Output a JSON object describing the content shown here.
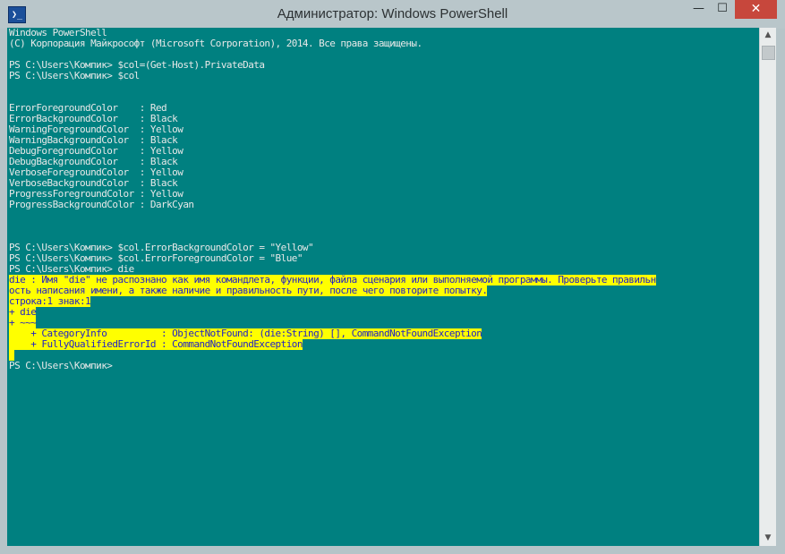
{
  "window": {
    "title": "Администратор: Windows PowerShell",
    "app_icon_glyph": "❯_",
    "buttons": {
      "minimize": "—",
      "maximize": "☐",
      "close": "✕"
    }
  },
  "colors": {
    "console_background": "#008080",
    "console_foreground": "#e8e8e8",
    "error_background": "#ffff00",
    "error_foreground": "#1f1fc8",
    "close_button": "#c7473c"
  },
  "console": {
    "lines": [
      {
        "text": "Windows PowerShell",
        "type": "normal"
      },
      {
        "text": "(С) Корпорация Майкрософт (Microsoft Corporation), 2014. Все права защищены.",
        "type": "normal"
      },
      {
        "text": "",
        "type": "normal"
      },
      {
        "text": "PS C:\\Users\\Компик> $col=(Get-Host).PrivateData",
        "type": "normal"
      },
      {
        "text": "PS C:\\Users\\Компик> $col",
        "type": "normal"
      },
      {
        "text": "",
        "type": "normal"
      },
      {
        "text": "",
        "type": "normal"
      },
      {
        "text": "ErrorForegroundColor    : Red",
        "type": "normal"
      },
      {
        "text": "ErrorBackgroundColor    : Black",
        "type": "normal"
      },
      {
        "text": "WarningForegroundColor  : Yellow",
        "type": "normal"
      },
      {
        "text": "WarningBackgroundColor  : Black",
        "type": "normal"
      },
      {
        "text": "DebugForegroundColor    : Yellow",
        "type": "normal"
      },
      {
        "text": "DebugBackgroundColor    : Black",
        "type": "normal"
      },
      {
        "text": "VerboseForegroundColor  : Yellow",
        "type": "normal"
      },
      {
        "text": "VerboseBackgroundColor  : Black",
        "type": "normal"
      },
      {
        "text": "ProgressForegroundColor : Yellow",
        "type": "normal"
      },
      {
        "text": "ProgressBackgroundColor : DarkCyan",
        "type": "normal"
      },
      {
        "text": "",
        "type": "normal"
      },
      {
        "text": "",
        "type": "normal"
      },
      {
        "text": "",
        "type": "normal"
      },
      {
        "text": "PS C:\\Users\\Компик> $col.ErrorBackgroundColor = \"Yellow\"",
        "type": "normal"
      },
      {
        "text": "PS C:\\Users\\Компик> $col.ErrorForegroundColor = \"Blue\"",
        "type": "normal"
      },
      {
        "text": "PS C:\\Users\\Компик> die",
        "type": "normal"
      },
      {
        "text": "die : Имя \"die\" не распознано как имя командлета, функции, файла сценария или выполняемой программы. Проверьте правильн",
        "type": "error"
      },
      {
        "text": "ость написания имени, а также наличие и правильность пути, после чего повторите попытку.",
        "type": "error"
      },
      {
        "text": "строка:1 знак:1",
        "type": "error"
      },
      {
        "text": "+ die",
        "type": "error"
      },
      {
        "text": "+ ~~~",
        "type": "error"
      },
      {
        "text": "    + CategoryInfo          : ObjectNotFound: (die:String) [], CommandNotFoundException",
        "type": "error"
      },
      {
        "text": "    + FullyQualifiedErrorId : CommandNotFoundException",
        "type": "error"
      },
      {
        "text": " ",
        "type": "error"
      },
      {
        "text": "PS C:\\Users\\Компик>",
        "type": "normal"
      }
    ]
  },
  "scrollbar": {
    "up_arrow": "▲",
    "down_arrow": "▼"
  }
}
